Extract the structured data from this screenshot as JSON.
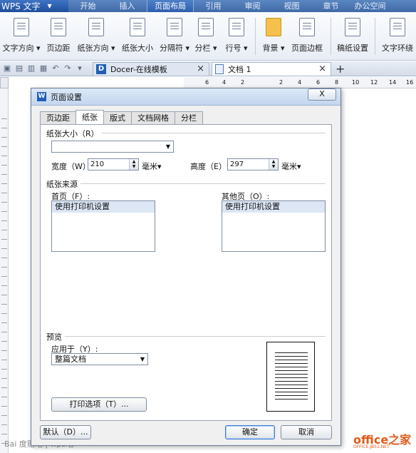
{
  "app": {
    "menu_button": "WPS 文字",
    "menu": [
      "开始",
      "插入",
      "页面布局",
      "引用",
      "审阅",
      "视图",
      "章节",
      "办公空间"
    ],
    "active_menu": "页面布局"
  },
  "ribbon": {
    "buttons": [
      "文字方向 ▾",
      "页边距",
      "纸张方向 ▾",
      "纸张大小",
      "分隔符 ▾",
      "分栏 ▾",
      "行号 ▾",
      "背景 ▾",
      "页面边框",
      "稿纸设置",
      "文字环绕"
    ]
  },
  "tabs": {
    "docer": "Docer-在线模板",
    "doc1": "文档 1",
    "close": "×",
    "new": "+"
  },
  "ruler": {
    "ticks": [
      "6",
      "4",
      "2",
      "2",
      "4",
      "6",
      "8",
      "10",
      "12",
      "14",
      "16"
    ]
  },
  "dialog": {
    "title": "页面设置",
    "close": "X",
    "tabs": [
      "页边距",
      "纸张",
      "版式",
      "文档网格",
      "分栏"
    ],
    "selected_tab": "纸张",
    "paper_size_group": "纸张大小（R）",
    "paper_size_value": "",
    "width_label": "宽度（W）:",
    "width_value": "210",
    "height_label": "高度（E）:",
    "height_value": "297",
    "unit": "毫米▾",
    "paper_source_group": "纸张来源",
    "first_page_label": "首页（F）:",
    "first_page_option": "使用打印机设置",
    "other_pages_label": "其他页（O）:",
    "other_pages_option": "使用打印机设置",
    "preview_group": "预览",
    "apply_to_label": "应用于（Y）:",
    "apply_to_value": "整篇文档",
    "print_options": "打印选项（T）...",
    "default_button": "默认（D）...",
    "ok_button": "确定",
    "cancel_button": "取消"
  },
  "watermarks": {
    "baidu": "Bai 度贴吧 | wps吧",
    "office": "office之家",
    "office_sub": "OFFICE.JB51.NET"
  }
}
